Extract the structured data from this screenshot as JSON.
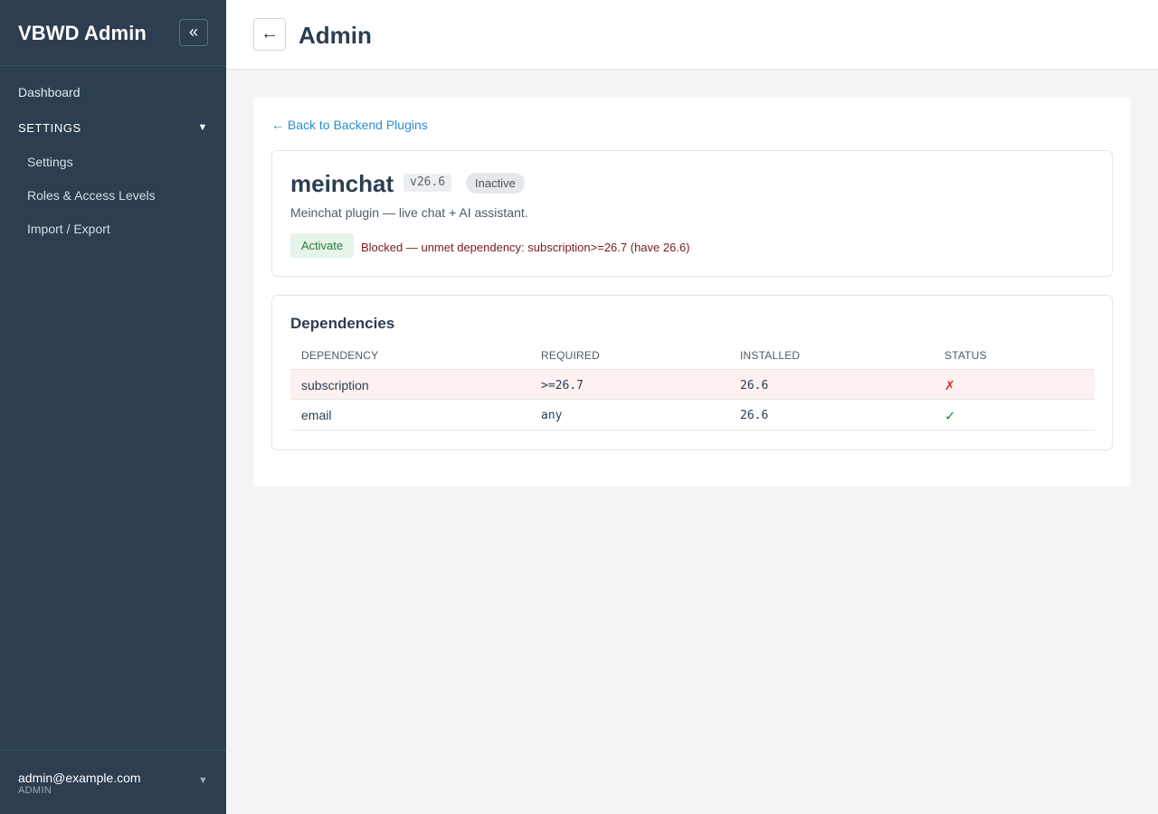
{
  "sidebar": {
    "brand": "VBWD Admin",
    "collapse_label": "«",
    "nav": {
      "dashboard": "Dashboard",
      "section_label": "SETTINGS",
      "section_caret": "▼",
      "items": [
        {
          "label": "Settings"
        },
        {
          "label": "Roles & Access Levels"
        },
        {
          "label": "Import / Export"
        }
      ]
    },
    "user": {
      "email": "admin@example.com",
      "role": "ADMIN",
      "caret": "▼"
    }
  },
  "header": {
    "back_label": "←",
    "title": "Admin"
  },
  "main": {
    "back_link": "← Back to Backend Plugins",
    "plugin": {
      "name": "meinchat",
      "version": "v26.6",
      "status": "Inactive",
      "description": "Meinchat plugin — live chat + AI assistant.",
      "activate_label": "Activate",
      "blocked_message": "Blocked — unmet dependency: subscription>=26.7 (have 26.6)"
    },
    "dependencies": {
      "title": "Dependencies",
      "columns": [
        "DEPENDENCY",
        "REQUIRED",
        "INSTALLED",
        "STATUS"
      ],
      "rows": [
        {
          "name": "subscription",
          "required": ">=26.7",
          "installed": "26.6",
          "status": "✗",
          "met": false
        },
        {
          "name": "email",
          "required": "any",
          "installed": "26.6",
          "status": "✓",
          "met": true
        }
      ]
    }
  },
  "colors": {
    "sidebar_bg": "#2c3e50",
    "link": "#2a8ed1",
    "error_row_bg": "#fdf1f1",
    "fail": "#d0302a",
    "ok": "#2a8a3a",
    "blocked_text": "#7a1a1a"
  }
}
